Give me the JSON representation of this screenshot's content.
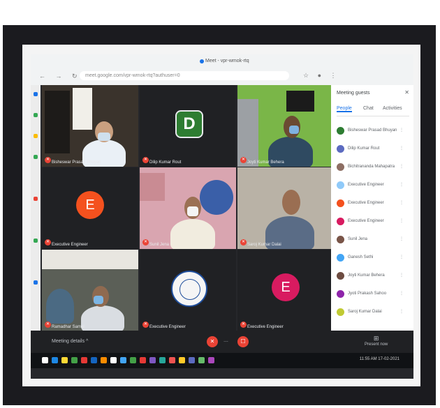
{
  "browser": {
    "tab_title": "Meet - vpr-wmok-rtq",
    "url": "meet.google.com/vpr-wmok-rtq?authuser=0",
    "nav_icons": "← → ↻",
    "ext_icons": "☆ ● ⋮"
  },
  "tiles": [
    {
      "name": "Bisheswar Prasad Bhuyan",
      "kind": "video"
    },
    {
      "name": "Dilip Kumar Rout",
      "kind": "avatar-square",
      "initial": "D",
      "color": "#2e7d32"
    },
    {
      "name": "Joyti Kumar Behera",
      "kind": "video"
    },
    {
      "name": "Executive Engineer",
      "kind": "avatar-circle",
      "initial": "E",
      "color": "#f4511e"
    },
    {
      "name": "Sunil Jena",
      "kind": "video"
    },
    {
      "name": "Saroj Kumar Dalai",
      "kind": "video"
    },
    {
      "name": "Ramadhar Samal",
      "kind": "video"
    },
    {
      "name": "Executive Engineer",
      "kind": "logo"
    },
    {
      "name": "Executive Engineer",
      "kind": "avatar-circle",
      "initial": "E",
      "color": "#d81b60"
    }
  ],
  "panel": {
    "title": "Meeting guests",
    "tabs": [
      "People",
      "Chat",
      "Activities"
    ],
    "participants": [
      {
        "name": "Bisheswar Prasad Bhuyan",
        "color": "#2e7d32"
      },
      {
        "name": "Dilip Kumar Rout",
        "color": "#5c6bc0"
      },
      {
        "name": "Bichitrananda Mahapatra",
        "color": "#8d6e63"
      },
      {
        "name": "Executive Engineer",
        "color": "#90caf9"
      },
      {
        "name": "Executive Engineer",
        "color": "#f4511e"
      },
      {
        "name": "Executive Engineer",
        "color": "#d81b60"
      },
      {
        "name": "Sunil Jena",
        "color": "#795548"
      },
      {
        "name": "Ganesh Sethi",
        "color": "#42a5f5"
      },
      {
        "name": "Joyti Kumar Behera",
        "color": "#6d4c41"
      },
      {
        "name": "Jyoti Prakash Sahoo",
        "color": "#8e24aa"
      },
      {
        "name": "Saroj Kumar Dalai",
        "color": "#c0ca33"
      }
    ]
  },
  "controls": {
    "meeting_details": "Meeting details ^",
    "mic": "✕",
    "cam": "☐",
    "hangup": "⋯",
    "present": "Present now",
    "present_icon": "⊞"
  },
  "taskbar": {
    "clock": "11:55 AM  17-02-2021",
    "icon_colors": [
      "#ffffff",
      "#1e88e5",
      "#fdd835",
      "#43a047",
      "#e53935",
      "#1565c0",
      "#fb8c00",
      "#ffffff",
      "#42a5f5",
      "#43a047",
      "#e53935",
      "#7e57c2",
      "#26a69a",
      "#ef5350",
      "#ffca28",
      "#5c6bc0",
      "#66bb6a",
      "#ab47bc"
    ]
  }
}
